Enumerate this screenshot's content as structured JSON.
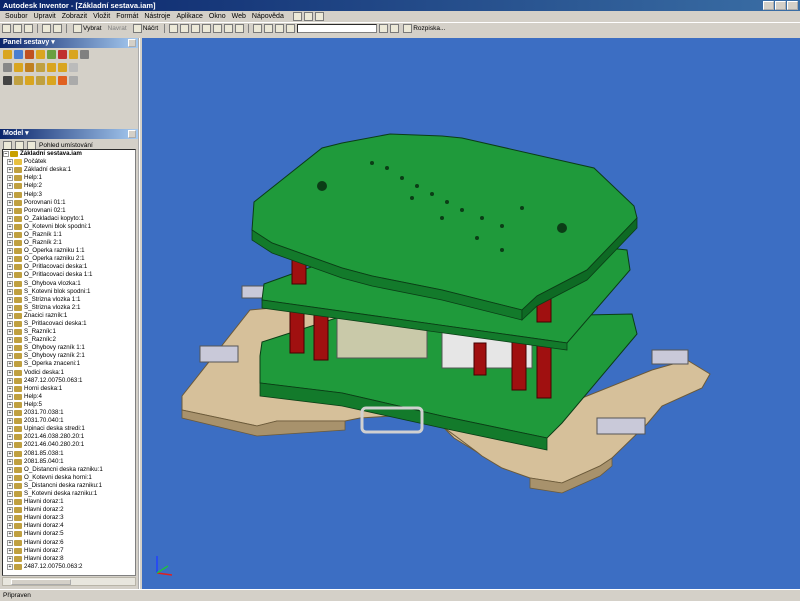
{
  "window": {
    "title": "Autodesk Inventor - [Základní sestava.iam]"
  },
  "menu": [
    "Soubor",
    "Upravit",
    "Zobrazit",
    "Vložit",
    "Formát",
    "Nástroje",
    "Aplikace",
    "Okno",
    "Web",
    "Nápověda"
  ],
  "toolbar2": {
    "select_label": "Vybrat",
    "nav_label": "Navrat",
    "sketch_label": "Náčrt",
    "view_label": "Rozpiska..."
  },
  "panel": {
    "title": "Panel sestavy"
  },
  "model": {
    "title": "Model",
    "filter_label": "Pohled umístování"
  },
  "tree": [
    {
      "label": "Základní sestava.iam",
      "root": true,
      "color": "#c8a000"
    },
    {
      "label": "Počátek",
      "color": "#e8c040"
    },
    {
      "label": "Základní deska:1",
      "color": "#c0a040"
    },
    {
      "label": "Help:1",
      "color": "#c0a040"
    },
    {
      "label": "Help:2",
      "color": "#c0a040"
    },
    {
      "label": "Help:3",
      "color": "#c0a040"
    },
    {
      "label": "Porovnani 01:1",
      "color": "#c0a040"
    },
    {
      "label": "Porovnani 02:1",
      "color": "#c0a040"
    },
    {
      "label": "O_Zakladaci kopyto:1",
      "color": "#c0a040"
    },
    {
      "label": "O_Kotevni blok spodni:1",
      "color": "#c0a040"
    },
    {
      "label": "O_Razník 1:1",
      "color": "#c0a040"
    },
    {
      "label": "O_Razník 2:1",
      "color": "#c0a040"
    },
    {
      "label": "O_Operka razniku 1:1",
      "color": "#c0a040"
    },
    {
      "label": "O_Operka razniku 2:1",
      "color": "#c0a040"
    },
    {
      "label": "O_Pritlacovaci deska:1",
      "color": "#c0a040"
    },
    {
      "label": "O_Pritlacovaci deska 1:1",
      "color": "#c0a040"
    },
    {
      "label": "S_Ohybova vlozka:1",
      "color": "#c0a040"
    },
    {
      "label": "S_Kotevni blok spodni:1",
      "color": "#c0a040"
    },
    {
      "label": "S_Strizna vlozka 1:1",
      "color": "#c0a040"
    },
    {
      "label": "S_Strizna vlozka 2:1",
      "color": "#c0a040"
    },
    {
      "label": "Znacici razník:1",
      "color": "#c0a040"
    },
    {
      "label": "S_Pritlacovaci deska:1",
      "color": "#c0a040"
    },
    {
      "label": "S_Razník:1",
      "color": "#c0a040"
    },
    {
      "label": "S_Razník:2",
      "color": "#c0a040"
    },
    {
      "label": "S_Ohybovy razník 1:1",
      "color": "#c0a040"
    },
    {
      "label": "S_Ohybovy razník 2:1",
      "color": "#c0a040"
    },
    {
      "label": "S_Operka znaceni:1",
      "color": "#c0a040"
    },
    {
      "label": "Vodici deska:1",
      "color": "#c0a040"
    },
    {
      "label": "2487.12.00750.063:1",
      "color": "#c0a040"
    },
    {
      "label": "Horni deska:1",
      "color": "#c0a040"
    },
    {
      "label": "Help:4",
      "color": "#c0a040"
    },
    {
      "label": "Help:5",
      "color": "#c0a040"
    },
    {
      "label": "2031.70.038:1",
      "color": "#c0a040"
    },
    {
      "label": "2031.70.040:1",
      "color": "#c0a040"
    },
    {
      "label": "Upinaci deska stredi:1",
      "color": "#c0a040"
    },
    {
      "label": "2021.46.038.280.20:1",
      "color": "#c0a040"
    },
    {
      "label": "2021.46.040.280.20:1",
      "color": "#c0a040"
    },
    {
      "label": "2081.85.038:1",
      "color": "#c0a040"
    },
    {
      "label": "2081.85.040:1",
      "color": "#c0a040"
    },
    {
      "label": "O_Distancni deska razniku:1",
      "color": "#c0a040"
    },
    {
      "label": "O_Kotevni deska horni:1",
      "color": "#c0a040"
    },
    {
      "label": "S_Distancni deska razniku:1",
      "color": "#c0a040"
    },
    {
      "label": "S_Kotevni deska razniku:1",
      "color": "#c0a040"
    },
    {
      "label": "Hlavni doraz:1",
      "color": "#c0a040"
    },
    {
      "label": "Hlavni doraz:2",
      "color": "#c0a040"
    },
    {
      "label": "Hlavni doraz:3",
      "color": "#c0a040"
    },
    {
      "label": "Hlavni doraz:4",
      "color": "#c0a040"
    },
    {
      "label": "Hlavni doraz:5",
      "color": "#c0a040"
    },
    {
      "label": "Hlavni doraz:6",
      "color": "#c0a040"
    },
    {
      "label": "Hlavni doraz:7",
      "color": "#c0a040"
    },
    {
      "label": "Hlavni doraz:8",
      "color": "#c0a040"
    },
    {
      "label": "2487.12.00750.063:2",
      "color": "#c0a040"
    }
  ],
  "status": {
    "text": "Připraven"
  },
  "colors": {
    "plate_green": "#1f9a3b",
    "base_tan": "#d6c09a",
    "pin_red": "#a01010",
    "viewport_blue": "#3c6ec3"
  }
}
